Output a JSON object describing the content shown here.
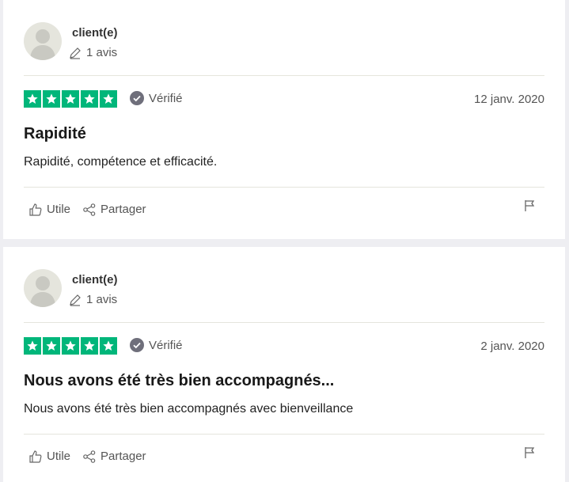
{
  "reviews": [
    {
      "author": "client(e)",
      "review_count": "1 avis",
      "rating": 5,
      "verified_label": "Vérifié",
      "date": "12 janv. 2020",
      "title": "Rapidité",
      "body": "Rapidité, compétence et efficacité.",
      "useful_label": "Utile",
      "share_label": "Partager"
    },
    {
      "author": "client(e)",
      "review_count": "1 avis",
      "rating": 5,
      "verified_label": "Vérifié",
      "date": "2 janv. 2020",
      "title": "Nous avons été très bien accompagnés...",
      "body": "Nous avons été très bien accompagnés avec bienveillance",
      "useful_label": "Utile",
      "share_label": "Partager"
    }
  ],
  "colors": {
    "star_green": "#00b67a",
    "verified_icon": "#6f6f7b"
  },
  "icons": [
    "avatar-silhouette",
    "pencil-icon",
    "star-icon",
    "check-badge-icon",
    "thumbs-up-icon",
    "share-icon",
    "flag-icon"
  ]
}
